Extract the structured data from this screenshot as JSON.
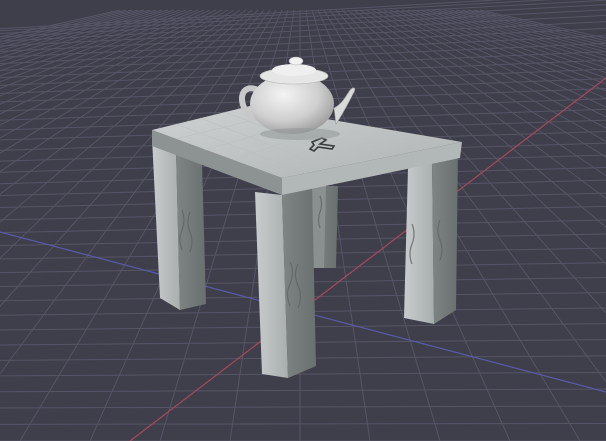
{
  "viewport": {
    "view": "perspective",
    "background_color": "#3f3e4b",
    "grid_line_color": "#565566",
    "x_axis_color": "#a8485e",
    "y_axis_color": "#5a5aa8",
    "origin_marker": "object-origin-cross"
  },
  "scene": {
    "objects": [
      {
        "name": "table",
        "type": "mesh",
        "material": "wood-texture"
      },
      {
        "name": "teapot",
        "type": "mesh",
        "material": "default-grey"
      }
    ]
  }
}
